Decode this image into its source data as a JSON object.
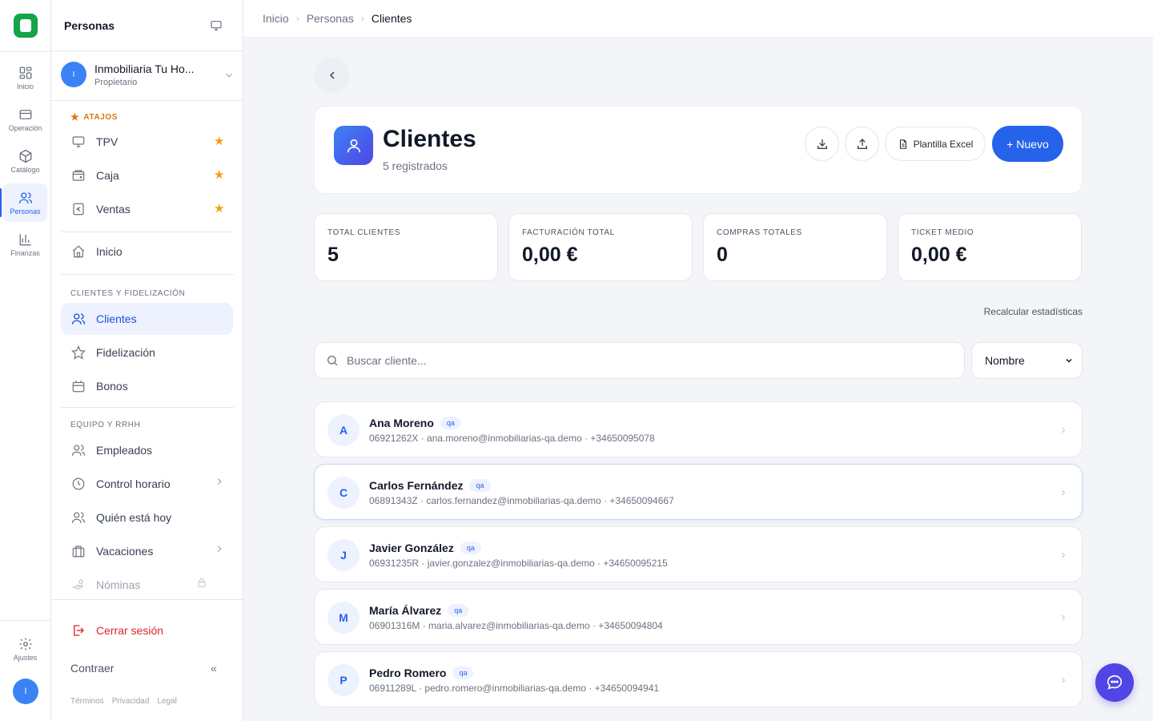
{
  "rail": {
    "items": [
      {
        "label": "Inicio",
        "icon": "grid-icon"
      },
      {
        "label": "Operación",
        "icon": "card-icon"
      },
      {
        "label": "Catálogo",
        "icon": "box-icon"
      },
      {
        "label": "Personas",
        "icon": "users-icon",
        "active": true
      },
      {
        "label": "Finanzas",
        "icon": "bar-chart-icon"
      }
    ],
    "settings_label": "Ajustes",
    "avatar_initial": "I"
  },
  "sidebar": {
    "title": "Personas",
    "org": {
      "name": "Inmobiliaria Tu Ho...",
      "role": "Propietario",
      "initial": "I"
    },
    "shortcuts_header": "ATAJOS",
    "shortcuts": [
      {
        "label": "TPV",
        "icon": "monitor-icon"
      },
      {
        "label": "Caja",
        "icon": "wallet-icon"
      },
      {
        "label": "Ventas",
        "icon": "euro-receipt-icon"
      }
    ],
    "home_label": "Inicio",
    "section_clients": "CLIENTES Y FIDELIZACIÓN",
    "clients_items": [
      {
        "label": "Clientes",
        "icon": "users-icon",
        "active": true
      },
      {
        "label": "Fidelización",
        "icon": "star-outline-icon"
      },
      {
        "label": "Bonos",
        "icon": "calendar-box-icon"
      }
    ],
    "section_team": "EQUIPO Y RRHH",
    "team_items": [
      {
        "label": "Empleados",
        "icon": "users-icon"
      },
      {
        "label": "Control horario",
        "icon": "clock-icon",
        "chevron": true
      },
      {
        "label": "Quién está hoy",
        "icon": "users-icon"
      },
      {
        "label": "Vacaciones",
        "icon": "suitcase-icon",
        "chevron": true
      },
      {
        "label": "Nóminas",
        "icon": "money-hand-icon",
        "locked": true
      }
    ],
    "logout_label": "Cerrar sesión",
    "collapse_label": "Contraer",
    "legal": [
      "Términos",
      "Privacidad",
      "Legal"
    ]
  },
  "breadcrumb": [
    "Inicio",
    "Personas",
    "Clientes"
  ],
  "header": {
    "title": "Clientes",
    "subtitle": "5 registrados",
    "excel_label": "Plantilla Excel",
    "new_label": "+ Nuevo"
  },
  "stats": [
    {
      "label": "TOTAL CLIENTES",
      "value": "5"
    },
    {
      "label": "FACTURACIÓN TOTAL",
      "value": "0,00 €"
    },
    {
      "label": "COMPRAS TOTALES",
      "value": "0"
    },
    {
      "label": "TICKET MEDIO",
      "value": "0,00 €"
    }
  ],
  "recalc_label": "Recalcular estadísticas",
  "search": {
    "placeholder": "Buscar cliente...",
    "value": ""
  },
  "sort": {
    "selected": "Nombre"
  },
  "clients": [
    {
      "initial": "A",
      "name": "Ana Moreno",
      "tag": "qa",
      "meta": "06921262X · ana.moreno@inmobiliarias-qa.demo · +34650095078"
    },
    {
      "initial": "C",
      "name": "Carlos Fernández",
      "tag": "qa",
      "meta": "06891343Z · carlos.fernandez@inmobiliarias-qa.demo · +34650094667"
    },
    {
      "initial": "J",
      "name": "Javier González",
      "tag": "qa",
      "meta": "06931235R · javier.gonzalez@inmobiliarias-qa.demo · +34650095215"
    },
    {
      "initial": "M",
      "name": "María Álvarez",
      "tag": "qa",
      "meta": "06901316M · maria.alvarez@inmobiliarias-qa.demo · +34650094804"
    },
    {
      "initial": "P",
      "name": "Pedro Romero",
      "tag": "qa",
      "meta": "06911289L · pedro.romero@inmobiliarias-qa.demo · +34650094941"
    }
  ],
  "colors": {
    "accent": "#2563eb",
    "logo": "#16a34a",
    "star": "#f59e0b",
    "danger": "#dc2626"
  }
}
